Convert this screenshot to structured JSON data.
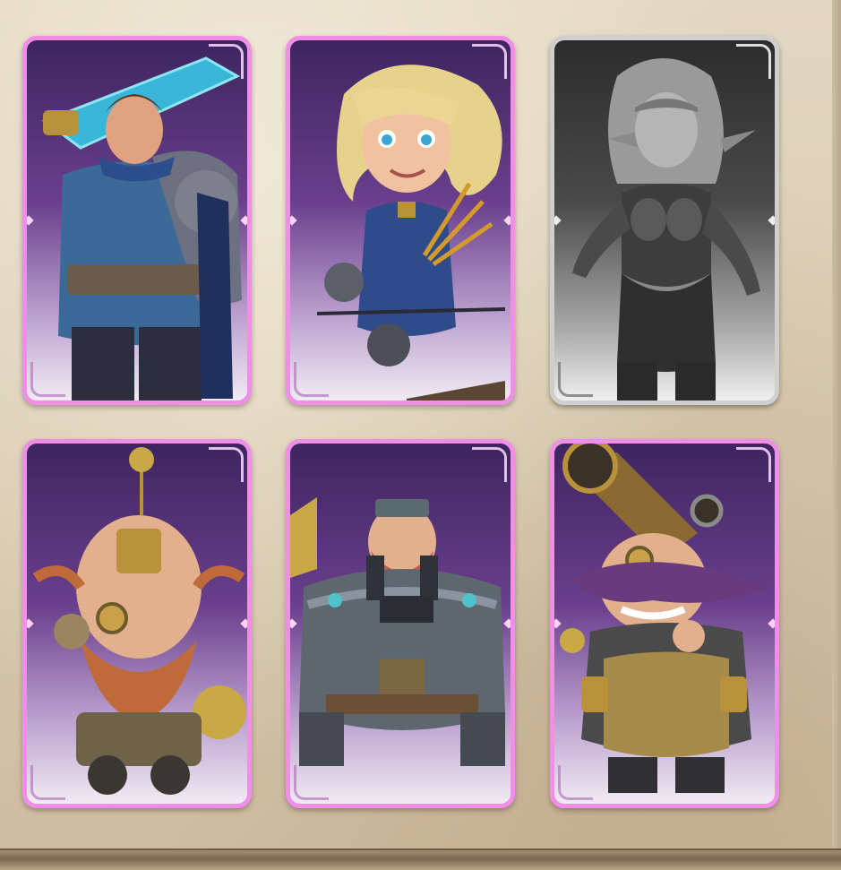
{
  "heroes": [
    {
      "name": "knight",
      "locked": false
    },
    {
      "name": "archer",
      "locked": false
    },
    {
      "name": "elf-sorceress",
      "locked": true
    },
    {
      "name": "engineer-dwarf",
      "locked": false
    },
    {
      "name": "mech-pilot-dwarf",
      "locked": false
    },
    {
      "name": "cannoneer-dwarf",
      "locked": false
    }
  ],
  "colors": {
    "card_border": "#f08ee8",
    "card_bg_top": "#3d2560",
    "locked_border": "#cfcfcf",
    "panel_bg": "#d9ccb4"
  }
}
